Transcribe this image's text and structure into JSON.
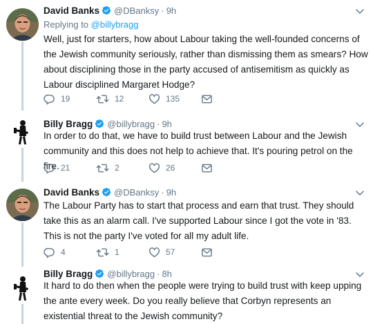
{
  "tweets": [
    {
      "name": "David Banks",
      "handle": "@DBanksy",
      "dot": "·",
      "time": "9h",
      "replying_prefix": "Replying to ",
      "replying_mention": "@billybragg",
      "text": "Well, just for starters, how about Labour taking the well-founded concerns of the Jewish community seriously, rather than dismissing them as smears? How about disciplining those in the party accused of antisemitism as quickly as Labour disciplined Margaret Hodge?",
      "replies": "19",
      "retweets": "12",
      "likes": "135"
    },
    {
      "name": "Billy Bragg",
      "handle": "@billybragg",
      "dot": "·",
      "time": "9h",
      "text": "In order to do that, we have to build trust between Labour and the Jewish community and this does not help to achieve that. It's pouring petrol on the fire.",
      "replies": "21",
      "retweets": "2",
      "likes": "26"
    },
    {
      "name": "David Banks",
      "handle": "@DBanksy",
      "dot": "·",
      "time": "9h",
      "text": "The Labour Party has to start that process and earn that trust. They should take this as an alarm call. I've supported Labour since I got the vote in '83. This is not the party I've voted for all my adult life.",
      "replies": "4",
      "retweets": "1",
      "likes": "57"
    },
    {
      "name": "Billy Bragg",
      "handle": "@billybragg",
      "dot": "·",
      "time": "8h",
      "text": "It hard to do then when the people were trying to build trust with keep upping the ante every week. Do you really believe that Corbyn represents an existential threat to the Jewish community?"
    }
  ],
  "icons": {
    "verified": "verified-badge-icon",
    "caret": "chevron-down-icon",
    "reply": "reply-icon",
    "retweet": "retweet-icon",
    "like": "heart-icon",
    "dm": "envelope-icon"
  },
  "colors": {
    "accent": "#1da1f2",
    "muted": "#657786",
    "text": "#14171a",
    "thread_line": "#c9d3db"
  }
}
